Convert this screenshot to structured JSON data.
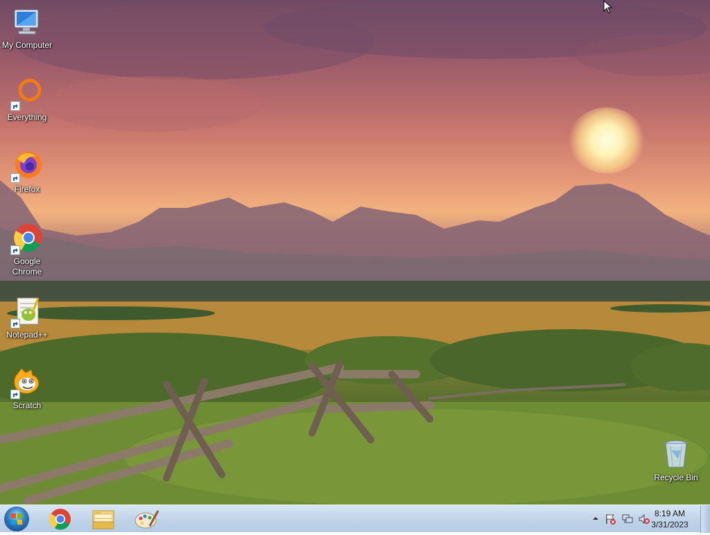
{
  "desktop_icons": [
    {
      "label": "My Computer",
      "icon": "computer-icon"
    },
    {
      "label": "Everything",
      "icon": "everything-icon"
    },
    {
      "label": "Firefox",
      "icon": "firefox-icon"
    },
    {
      "label": "Google Chrome",
      "icon": "chrome-icon"
    },
    {
      "label": "Notepad++",
      "icon": "notepadpp-icon"
    },
    {
      "label": "Scratch",
      "icon": "scratch-icon"
    },
    {
      "label": "Recycle Bin",
      "icon": "recycle-bin-icon"
    }
  ],
  "taskbar": {
    "pinned": [
      {
        "icon": "chrome-icon"
      },
      {
        "icon": "file-explorer-icon"
      },
      {
        "icon": "paint-icon"
      }
    ],
    "tray": {
      "icons": [
        "show-hidden-icons-arrow",
        "action-center-flag-icon",
        "network-icon",
        "volume-muted-icon"
      ],
      "time": "8:19 AM",
      "date": "3/31/2023"
    }
  },
  "colors": {
    "taskbar": "#c3d6ea",
    "sky": "#e69a78",
    "grass": "#6b8231"
  }
}
